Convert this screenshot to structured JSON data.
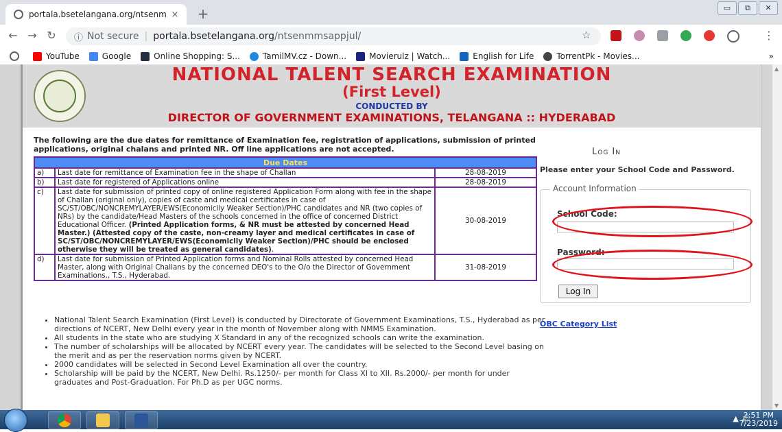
{
  "browser": {
    "tab_title": "portala.bsetelangana.org/ntsenm",
    "tab_close": "×",
    "new_tab": "+",
    "security": "Not secure",
    "url_domain": "portala.bsetelangana.org",
    "url_path": "/ntsenmmsappjul/",
    "window_controls": [
      "▭",
      "⧉",
      "✕"
    ]
  },
  "bookmarks": [
    {
      "label": "YouTube",
      "color": "#ff0000"
    },
    {
      "label": "Google",
      "color": "#4285f4"
    },
    {
      "label": "Online Shopping: S...",
      "color": "#232f3e"
    },
    {
      "label": "TamilMV.cz - Down...",
      "color": "#1e88e5"
    },
    {
      "label": "Movierulz | Watch...",
      "color": "#1a237e"
    },
    {
      "label": "English for Life",
      "color": "#1565c0"
    },
    {
      "label": "TorrentPk - Movies...",
      "color": "#444444"
    }
  ],
  "bookmarks_more": "»",
  "header": {
    "title": "NATIONAL TALENT SEARCH EXAMINATION",
    "subtitle": "(First Level)",
    "conducted": "CONDUCTED BY",
    "director": "DIRECTOR OF GOVERNMENT EXAMINATIONS, TELANGANA :: HYDERABAD"
  },
  "intro": "The following are the due dates for remittance of Examination fee, registration of applications, submission of printed applications, original chalans and printed NR. Off line applications are not accepted.",
  "due_table": {
    "heading": "Due Dates",
    "rows": [
      {
        "idx": "a)",
        "text": "Last date for remittance of Examination fee in the shape of Challan",
        "date": "28-08-2019"
      },
      {
        "idx": "b)",
        "text": "Last date for registered of Applications online",
        "date": "28-08-2019"
      },
      {
        "idx": "c)",
        "text": "Last date for submission of printed copy of online registered Application Form along with fee in the shape of Challan (original only), copies of caste and medical certificates in case of SC/ST/OBC/NONCREMYLAYER/EWS(Economiclly Weaker Section)/PHC candidates and NR (two copies of NRs) by the candidate/Head Masters of the schools concerned in the office of concerned District Educational Officer.",
        "bold": "(Printed Application forms, & NR must be attested by concerned Head Master.) (Attested copy of the caste, non-creamy layer and medical certificates in case of SC/ST/OBC/NONCREMYLAYER/EWS(Economiclly Weaker Section)/PHC should be enclosed otherwise they will be treated as general candidates)",
        "tail": ".",
        "date": "30-08-2019"
      },
      {
        "idx": "d)",
        "text": "Last date for submission of Printed Application forms and Nominal Rolls attested by concerned Head Master, along with Original Challans by the concerned DEO's to the O/o the Director of Government Examinations., T.S., Hyderabad.",
        "date": "31-08-2019"
      }
    ]
  },
  "bullets": [
    "National Talent Search Examination (First Level) is conducted by Directorate of Government Examinations, T.S., Hyderabad as per directions of NCERT, New Delhi every year in the month of November along with NMMS Examination.",
    "All students in the state who are studying X Standard in any of the recognized schools can write the examination.",
    "The number of scholarships will be allocated by NCERT every year. The candidates will be selected to the Second Level basing on the merit and as per the reservation norms given by NCERT.",
    "2000 candidates will be selected in Second Level Examination all over the country.",
    "Scholarship will be paid by the NCERT, New Delhi. Rs.1250/- per month for Class XI to XII. Rs.2000/- per month for under graduates and Post-Graduation. For Ph.D as per UGC norms."
  ],
  "login": {
    "title": "Log In",
    "prompt": "Please enter your School Code and Password.",
    "legend": "Account Information",
    "school_code_label": "School Code:",
    "school_code_value": "",
    "password_label": "Password:",
    "password_value": "",
    "button": "Log In"
  },
  "obc_link": "OBC Category List",
  "taskbar": {
    "time": "2:51 PM",
    "date": "7/23/2019",
    "tray_icons": "▲ 🔊"
  },
  "colors": {
    "header_red": "#d2232a",
    "header_blue": "#1e3aa6",
    "table_border": "#6a2c91",
    "table_head_bg": "#4d8cf5",
    "table_head_text": "#ffe24a",
    "annotation_red": "#e0141b",
    "link_blue": "#1a3fbf"
  }
}
